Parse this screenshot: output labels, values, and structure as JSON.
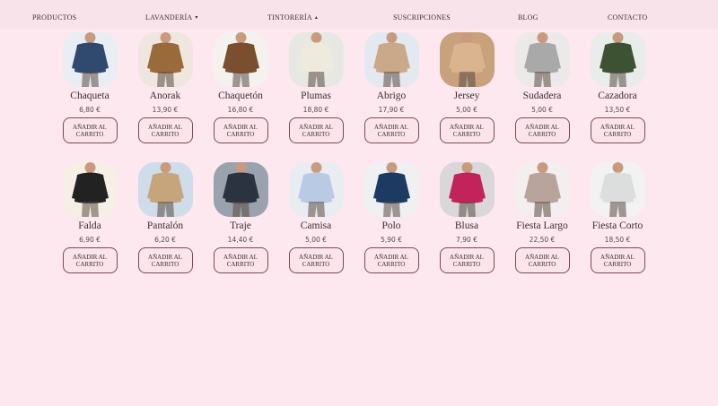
{
  "nav": [
    {
      "label": "PRODUCTOS",
      "caret": ""
    },
    {
      "label": "LAVANDERÍA",
      "caret": "▾"
    },
    {
      "label": "TINTORERÍA",
      "caret": "▴"
    },
    {
      "label": "SUSCRIPCIONES",
      "caret": ""
    },
    {
      "label": "BLOG",
      "caret": ""
    },
    {
      "label": "CONTACTO",
      "caret": ""
    }
  ],
  "button_label": "AÑADIR AL CARRITO",
  "products": [
    {
      "name": "Chaqueta",
      "price": "6,80 €",
      "icon": "denim-jacket-image",
      "bg": "#e9eef5",
      "garment": "#2f4a6e"
    },
    {
      "name": "Anorak",
      "price": "13,90 €",
      "icon": "puffer-jacket-image",
      "bg": "#efe7df",
      "garment": "#9a6a3a"
    },
    {
      "name": "Chaquetón",
      "price": "16,80 €",
      "icon": "shearling-coat-image",
      "bg": "#f4f1ee",
      "garment": "#7a4e2e"
    },
    {
      "name": "Plumas",
      "price": "18,80 €",
      "icon": "down-coat-image",
      "bg": "#e7e8e3",
      "garment": "#efeade"
    },
    {
      "name": "Abrigo",
      "price": "17,90 €",
      "icon": "trench-coat-image",
      "bg": "#e4e9f0",
      "garment": "#c9a98a"
    },
    {
      "name": "Jersey",
      "price": "5,00 €",
      "icon": "knit-sweater-image",
      "bg": "#c8a27c",
      "garment": "#d9b48e"
    },
    {
      "name": "Sudadera",
      "price": "5,00 €",
      "icon": "sweatshirt-image",
      "bg": "#eceae8",
      "garment": "#a9a9aa"
    },
    {
      "name": "Cazadora",
      "price": "13,50 €",
      "icon": "field-jacket-image",
      "bg": "#e8ecea",
      "garment": "#3c5232"
    },
    {
      "name": "Falda",
      "price": "6,90 €",
      "icon": "striped-skirt-image",
      "bg": "#f5efe6",
      "garment": "#222222"
    },
    {
      "name": "Pantalón",
      "price": "6,20 €",
      "icon": "chino-trousers-image",
      "bg": "#cfdcea",
      "garment": "#c7a57c"
    },
    {
      "name": "Traje",
      "price": "14,40 €",
      "icon": "suit-image",
      "bg": "#9aa3ad",
      "garment": "#2b3340"
    },
    {
      "name": "Camisa",
      "price": "5,00 €",
      "icon": "dress-shirt-image",
      "bg": "#e9edf2",
      "garment": "#b9cbe4"
    },
    {
      "name": "Polo",
      "price": "5,90 €",
      "icon": "polo-shirt-image",
      "bg": "#eef0f2",
      "garment": "#1d3a63"
    },
    {
      "name": "Blusa",
      "price": "7,90 €",
      "icon": "blouse-image",
      "bg": "#d9d7d9",
      "garment": "#c2235a"
    },
    {
      "name": "Fiesta Largo",
      "price": "22,50 €",
      "icon": "long-dress-image",
      "bg": "#f2efee",
      "garment": "#b9a49c"
    },
    {
      "name": "Fiesta Corto",
      "price": "18,50 €",
      "icon": "short-dress-image",
      "bg": "#f3f2f2",
      "garment": "#dcdedd"
    }
  ]
}
